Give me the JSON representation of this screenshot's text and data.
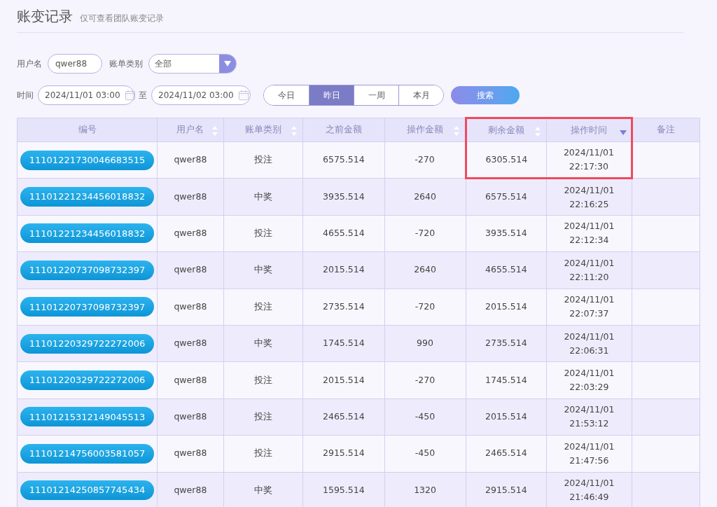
{
  "page": {
    "title": "账变记录",
    "subtitle": "仅可查看团队账变记录"
  },
  "filters": {
    "username_label": "用户名",
    "username_value": "qwer88",
    "category_label": "账单类别",
    "category_value": "全部",
    "time_label": "时间",
    "time_from": "2024/11/01 03:00",
    "to_label": "至",
    "time_to": "2024/11/02 03:00",
    "ranges": [
      {
        "label": "今日",
        "selected": false
      },
      {
        "label": "昨日",
        "selected": true
      },
      {
        "label": "一周",
        "selected": false
      },
      {
        "label": "本月",
        "selected": false
      }
    ],
    "search_button": "搜索"
  },
  "table": {
    "columns": [
      {
        "label": "编号",
        "sortable": false,
        "sorted_desc": false,
        "highlighted": false
      },
      {
        "label": "用户名",
        "sortable": true,
        "sorted_desc": false,
        "highlighted": false
      },
      {
        "label": "账单类别",
        "sortable": true,
        "sorted_desc": false,
        "highlighted": false
      },
      {
        "label": "之前金额",
        "sortable": false,
        "sorted_desc": false,
        "highlighted": false
      },
      {
        "label": "操作金额",
        "sortable": true,
        "sorted_desc": false,
        "highlighted": false
      },
      {
        "label": "剩余金额",
        "sortable": true,
        "sorted_desc": false,
        "highlighted": true
      },
      {
        "label": "操作时间",
        "sortable": false,
        "sorted_desc": true,
        "highlighted": true
      },
      {
        "label": "备注",
        "sortable": false,
        "sorted_desc": false,
        "highlighted": false
      }
    ],
    "rows": [
      {
        "id": "11101221730046683515",
        "user": "qwer88",
        "type": "投注",
        "before": "6575.514",
        "amount": "-270",
        "after": "6305.514",
        "date": "2024/11/01",
        "time": "22:17:30",
        "highlighted": true
      },
      {
        "id": "11101221234456018832",
        "user": "qwer88",
        "type": "中奖",
        "before": "3935.514",
        "amount": "2640",
        "after": "6575.514",
        "date": "2024/11/01",
        "time": "22:16:25",
        "highlighted": false
      },
      {
        "id": "11101221234456018832",
        "user": "qwer88",
        "type": "投注",
        "before": "4655.514",
        "amount": "-720",
        "after": "3935.514",
        "date": "2024/11/01",
        "time": "22:12:34",
        "highlighted": false
      },
      {
        "id": "11101220737098732397",
        "user": "qwer88",
        "type": "中奖",
        "before": "2015.514",
        "amount": "2640",
        "after": "4655.514",
        "date": "2024/11/01",
        "time": "22:11:20",
        "highlighted": false
      },
      {
        "id": "11101220737098732397",
        "user": "qwer88",
        "type": "投注",
        "before": "2735.514",
        "amount": "-720",
        "after": "2015.514",
        "date": "2024/11/01",
        "time": "22:07:37",
        "highlighted": false
      },
      {
        "id": "11101220329722272006",
        "user": "qwer88",
        "type": "中奖",
        "before": "1745.514",
        "amount": "990",
        "after": "2735.514",
        "date": "2024/11/01",
        "time": "22:06:31",
        "highlighted": false
      },
      {
        "id": "11101220329722272006",
        "user": "qwer88",
        "type": "投注",
        "before": "2015.514",
        "amount": "-270",
        "after": "1745.514",
        "date": "2024/11/01",
        "time": "22:03:29",
        "highlighted": false
      },
      {
        "id": "11101215312149045513",
        "user": "qwer88",
        "type": "投注",
        "before": "2465.514",
        "amount": "-450",
        "after": "2015.514",
        "date": "2024/11/01",
        "time": "21:53:12",
        "highlighted": false
      },
      {
        "id": "11101214756003581057",
        "user": "qwer88",
        "type": "投注",
        "before": "2915.514",
        "amount": "-450",
        "after": "2465.514",
        "date": "2024/11/01",
        "time": "21:47:56",
        "highlighted": false
      },
      {
        "id": "11101214250857745434",
        "user": "qwer88",
        "type": "中奖",
        "before": "1595.514",
        "amount": "1320",
        "after": "2915.514",
        "date": "2024/11/01",
        "time": "21:46:49",
        "highlighted": false
      }
    ]
  }
}
